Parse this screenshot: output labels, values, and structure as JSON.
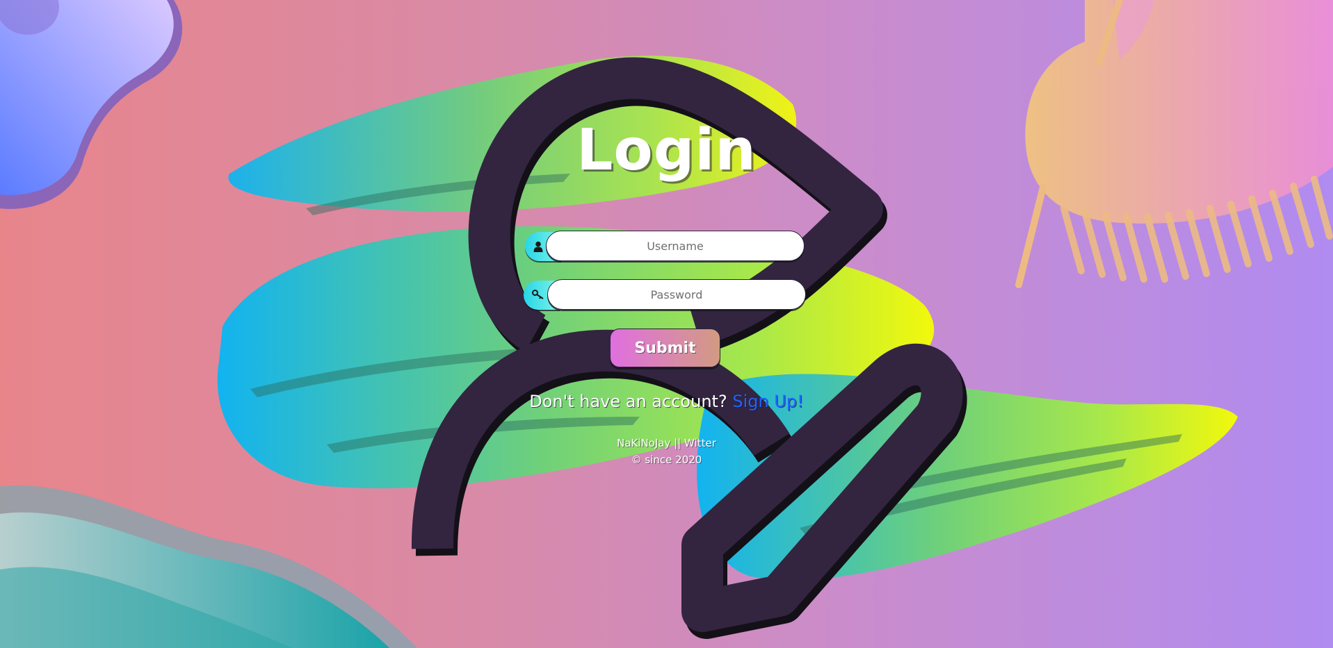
{
  "login": {
    "title": "Login",
    "username_placeholder": "Username",
    "password_placeholder": "Password",
    "submit_label": "Submit",
    "signup_prompt": "Don't have an account?",
    "signup_link": "Sign Up!"
  },
  "footer": {
    "brand": "NaKiNoJay || Witter",
    "copyright": "© since 2020"
  },
  "icons": {
    "username_icon": "user-icon",
    "password_icon": "key-icon"
  },
  "colors": {
    "background_left": "#e8858b",
    "background_right": "#b08bf0",
    "logo_dark": "#332540",
    "link": "#1e63ff",
    "field_icon": "#27d6e8",
    "submit_start": "#e06fe0",
    "submit_end": "#d29a82"
  }
}
